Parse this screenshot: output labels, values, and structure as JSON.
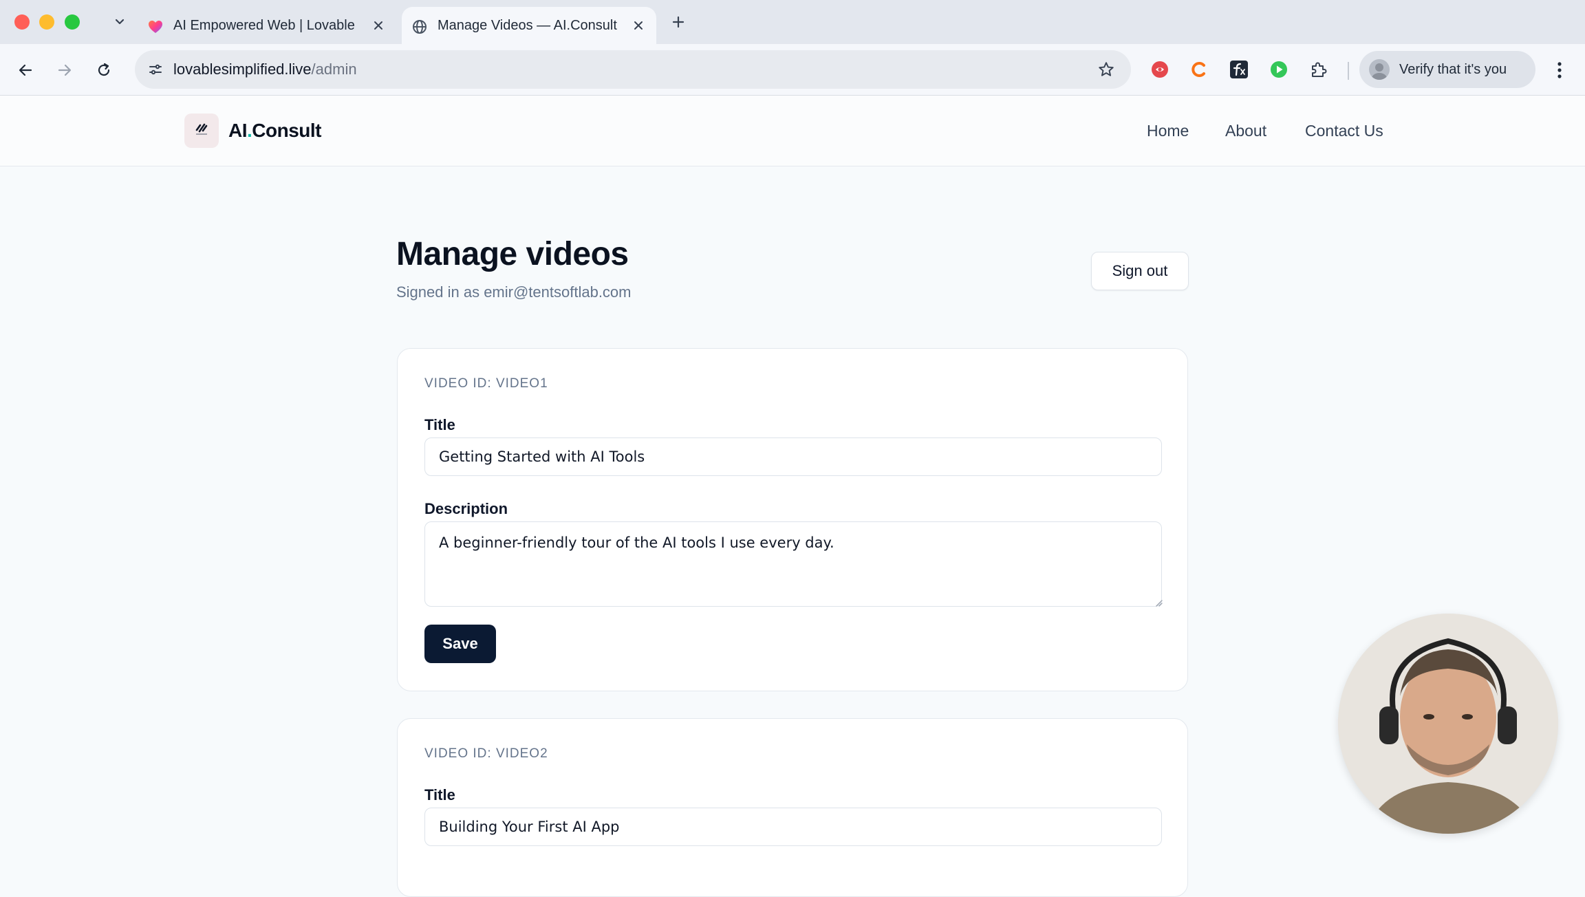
{
  "browser": {
    "tabs": [
      {
        "title": "AI Empowered Web | Lovable",
        "active": false
      },
      {
        "title": "Manage Videos — AI.Consult",
        "active": true
      }
    ],
    "url_host": "lovablesimplified.live",
    "url_path": "/admin",
    "profile_label": "Verify that it's you"
  },
  "site": {
    "logo_prefix": "AI",
    "logo_dot": ".",
    "logo_suffix": "Consult",
    "nav": [
      "Home",
      "About",
      "Contact Us"
    ]
  },
  "admin": {
    "title": "Manage videos",
    "signed_in": "Signed in as emir@tentsoftlab.com",
    "sign_out_label": "Sign out"
  },
  "videos": [
    {
      "id_label": "VIDEO ID: VIDEO1",
      "title_label": "Title",
      "title_value": "Getting Started with AI Tools",
      "description_label": "Description",
      "description_value": "A beginner-friendly tour of the AI tools I use every day.",
      "save_label": "Save"
    },
    {
      "id_label": "VIDEO ID: VIDEO2",
      "title_label": "Title",
      "title_value": "Building Your First AI App"
    }
  ],
  "colors": {
    "primary_button": "#0b1a33",
    "logo_accent": "#14b8a6",
    "page_background": "#f7fafc"
  }
}
